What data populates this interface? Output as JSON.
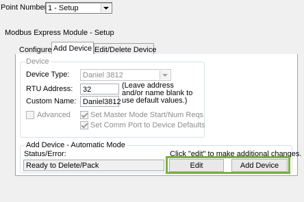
{
  "toolbar": {
    "point_number_label": "Point Number :",
    "point_number_value": "1 - Setup"
  },
  "module_title": "Modbus Express Module - Setup",
  "tabs": [
    {
      "label": "Configure",
      "active": false
    },
    {
      "label": "Add Device",
      "active": true
    },
    {
      "label": "Edit/Delete Device",
      "active": false
    }
  ],
  "device_group": {
    "legend": "Device",
    "device_type_label": "Device Type:",
    "device_type_value": "Daniel 3812",
    "rtu_address_label": "RTU Address:",
    "rtu_address_value": "32",
    "custom_name_label": "Custom Name:",
    "custom_name_value": "Daniel3812",
    "hint_line1": "(Leave address",
    "hint_line2": "and/or name blank to",
    "hint_line3": "use default values.)",
    "advanced_label": "Advanced",
    "advanced_checked": false,
    "master_mode_label": "Set Master Mode Start/Num Reqs",
    "master_mode_checked": true,
    "comm_port_label": "Set Comm Port to Device Defaults",
    "comm_port_checked": true
  },
  "auto_group": {
    "legend": "Add Device - Automatic Mode",
    "status_label": "Status/Error:",
    "click_hint": "Click \"edit\" to make additional changes.",
    "status_value": "Ready to Delete/Pack",
    "edit_button": "Edit",
    "add_device_button": "Add Device"
  },
  "colors": {
    "highlight": "#7ab041",
    "panel_bg": "#f0f0f0",
    "disabled_text": "#8d8d8d"
  }
}
